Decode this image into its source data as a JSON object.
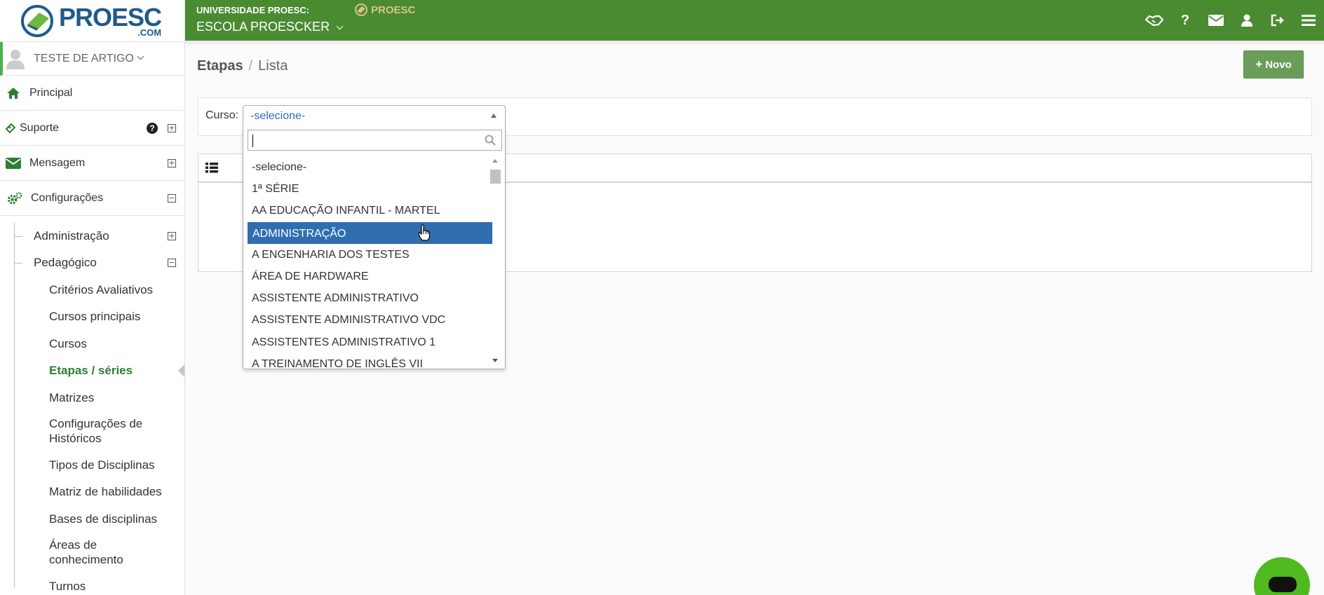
{
  "brand": {
    "logo_word": "PROESC",
    "logo_com": ".COM"
  },
  "user": {
    "name": "TESTE DE ARTIGO"
  },
  "sidebar": {
    "items": [
      {
        "label": "Principal"
      },
      {
        "label": "Suporte"
      },
      {
        "label": "Mensagem"
      },
      {
        "label": "Configurações"
      }
    ],
    "sub_items": [
      {
        "label": "Administração",
        "toggle": "⊞"
      },
      {
        "label": "Pedagógico",
        "toggle": "⊟"
      }
    ],
    "leaves": [
      "Critérios Avaliativos",
      "Cursos principais",
      "Cursos",
      "Etapas / séries",
      "Matrizes",
      "Configurações de Históricos",
      "Tipos de Disciplinas",
      "Matriz de habilidades",
      "Bases de disciplinas",
      "Áreas de conhecimento",
      "Turnos"
    ],
    "help_symbol": "?",
    "plus_symbol": "+",
    "minus_symbol": "−"
  },
  "topbar": {
    "university": "UNIVERSIDADE PROESC:",
    "school": "ESCOLA PROESCKER",
    "mini_logo": "PROESC",
    "icons": [
      "handshake-icon",
      "question-icon",
      "envelope-icon",
      "user-icon",
      "sign-out-icon",
      "menu-icon"
    ],
    "help_glyph": "?",
    "color": "#4a8b32"
  },
  "breadcrumb": {
    "section": "Etapas",
    "separator": "/",
    "page": "Lista"
  },
  "actions": {
    "new_label": "Novo",
    "new_icon": "+"
  },
  "filter": {
    "curso_label": "Curso:",
    "selected": "-selecione-",
    "search_value": "",
    "options": [
      "-selecione-",
      "1ª SÉRIE",
      "AA EDUCAÇÃO INFANTIL - MARTEL",
      "ADMINISTRAÇÃO",
      "A ENGENHARIA DOS TESTES",
      "ÁREA DE HARDWARE",
      "ASSISTENTE ADMINISTRATIVO",
      "ASSISTENTE ADMINISTRATIVO VDC",
      "ASSISTENTES ADMINISTRATIVO 1",
      "A TREINAMENTO DE INGLÊS VII"
    ],
    "highlighted_index": 3,
    "highlight_color": "#2f6fb0"
  },
  "accent": {
    "green": "#2e7d32",
    "button": "#6a9e58",
    "chat": "#4fba1f"
  }
}
